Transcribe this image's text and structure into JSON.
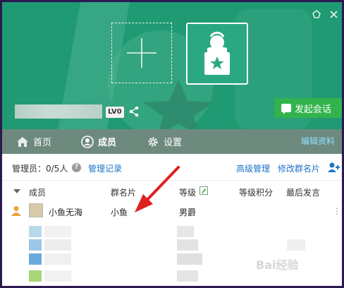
{
  "window": {
    "level_badge": "LV0",
    "start_chat_label": "发起会话"
  },
  "nav": {
    "tabs": [
      {
        "label": "首页",
        "icon": "home-icon"
      },
      {
        "label": "成员",
        "icon": "person-icon",
        "active": true
      },
      {
        "label": "设置",
        "icon": "gear-icon"
      }
    ],
    "edit_profile": "编辑资料"
  },
  "admin_bar": {
    "admins_text": "管理员：0/5人",
    "admin_log": "管理记录",
    "advanced_manage": "高级管理",
    "edit_group_card": "修改群名片"
  },
  "table": {
    "headers": [
      "成员",
      "群名片",
      "等级",
      "等级积分",
      "最后发言"
    ],
    "rows": [
      {
        "member": "小鱼无海",
        "card": "小鱼",
        "level": "男爵",
        "points": "",
        "last": ""
      }
    ]
  },
  "watermark": "Bai经验",
  "colors": {
    "banner": "#1f9a73",
    "navbar": "#6e8a7e",
    "link": "#1a73c7",
    "start_chat": "#32b34e",
    "arrow": "#e02020"
  }
}
